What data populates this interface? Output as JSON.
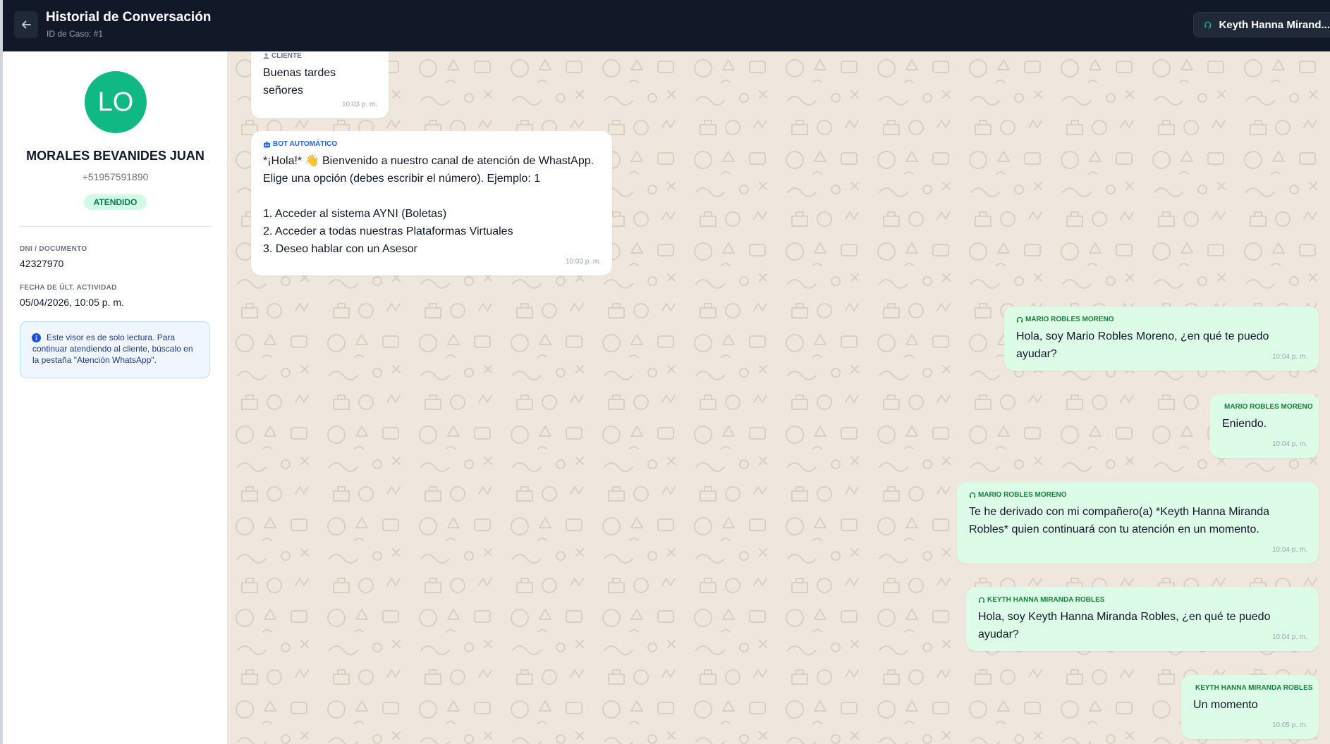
{
  "header": {
    "title": "Historial de Conversación",
    "case_id": "ID de Caso: #1",
    "agent_name": "Keyth Hanna Mirand..."
  },
  "client": {
    "initials": "LO",
    "name": "MORALES BEVANIDES JUAN",
    "phone": "+51957591890",
    "status": "ATENDIDO",
    "dni_label": "DNI / DOCUMENTO",
    "dni_value": "42327970",
    "activity_label": "FECHA DE ÚLT. ACTIVIDAD",
    "activity_value": "05/04/2026, 10:05 p. m."
  },
  "notice": "Este visor es de solo lectura. Para continuar atendiendo al cliente, búscalo en la pestaña \"Atención WhatsApp\".",
  "messages": [
    {
      "sender": "CLIENTE",
      "text": "Buenas tardes señores",
      "time": "10:03 p. m."
    },
    {
      "sender": "BOT AUTOMÁTICO",
      "text": "*¡Hola!* 👋 Bienvenido a nuestro canal de atención de WhastApp.\nElige una opción (debes escribir el número). Ejemplo: 1\n\n1. Acceder al sistema AYNI (Boletas)\n2. Acceder a todas nuestras Plataformas Virtuales\n3. Deseo hablar con un Asesor",
      "time": "10:03 p. m."
    },
    {
      "sender": "MARIO ROBLES MORENO",
      "text": "Hola, soy Mario Robles Moreno, ¿en qué te puedo ayudar?",
      "time": "10:04 p. m."
    },
    {
      "sender": "MARIO ROBLES MORENO",
      "text": "Eniendo.",
      "time": "10:04 p. m."
    },
    {
      "sender": "MARIO ROBLES MORENO",
      "text": "Te he derivado con mi compañero(a) *Keyth Hanna Miranda\nRobles* quien continuará con tu atención en un momento.",
      "time": "10:04 p. m."
    },
    {
      "sender": "KEYTH HANNA MIRANDA ROBLES",
      "text": "Hola, soy Keyth Hanna Miranda Robles, ¿en qué te puedo ayudar?",
      "time": "10:04 p. m."
    },
    {
      "sender": "KEYTH HANNA MIRANDA ROBLES",
      "text": "Un momento",
      "time": "10:05 p. m."
    }
  ],
  "colors": {
    "header_bg": "#111827",
    "avatar_bg": "#10b981",
    "status_bg": "#d1fae5",
    "status_text": "#047857",
    "chat_bg": "#efe7de",
    "outgoing_bubble": "#dcfce7",
    "bot_label": "#2563eb"
  },
  "icons": {
    "back": "arrow-left-icon",
    "agent": "headset-icon",
    "client": "user-icon",
    "bot": "robot-icon",
    "info": "info-icon"
  }
}
